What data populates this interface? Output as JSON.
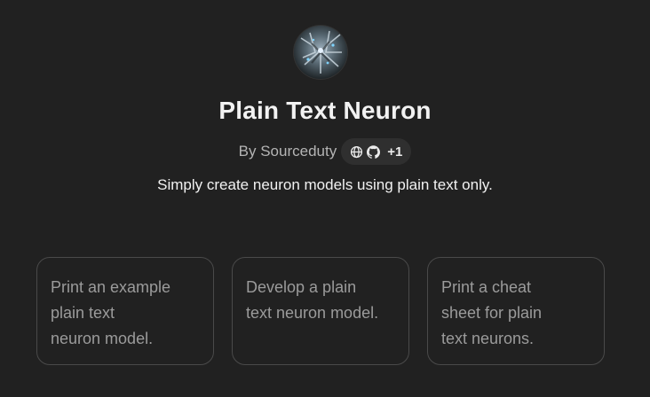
{
  "gpt": {
    "avatar_icon": "neuron-avatar-icon",
    "title": "Plain Text Neuron",
    "author": "By Sourceduty",
    "links": {
      "icons": [
        "globe-icon",
        "github-icon"
      ],
      "more": "+1"
    },
    "description": "Simply create neuron models using plain text only."
  },
  "starters": [
    {
      "lines": [
        "Print an example",
        "plain text",
        "neuron model."
      ]
    },
    {
      "lines": [
        "Develop a plain",
        "text neuron model."
      ]
    },
    {
      "lines": [
        "Print a cheat",
        "sheet for plain",
        "text neurons."
      ]
    }
  ],
  "colors": {
    "background": "#212121",
    "card_border": "#4a4a4a",
    "chip_background": "#2f2f2f",
    "muted_text": "#9b9b9b"
  }
}
